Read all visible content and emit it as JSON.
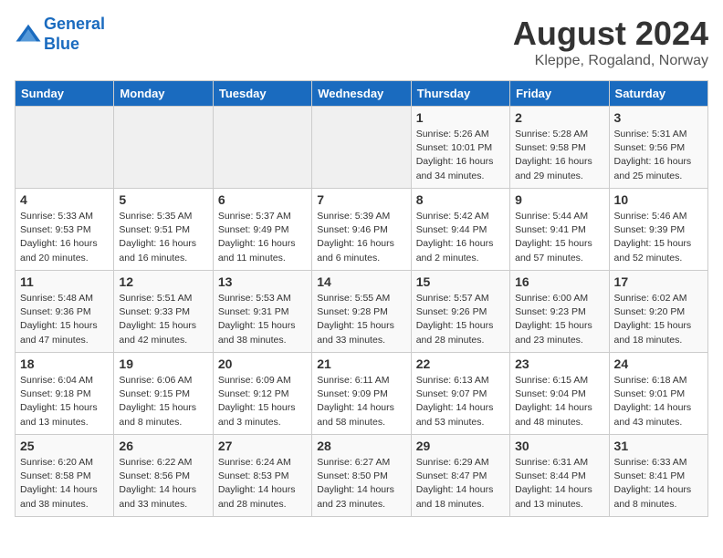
{
  "header": {
    "logo_line1": "General",
    "logo_line2": "Blue",
    "month_year": "August 2024",
    "location": "Kleppe, Rogaland, Norway"
  },
  "days_of_week": [
    "Sunday",
    "Monday",
    "Tuesday",
    "Wednesday",
    "Thursday",
    "Friday",
    "Saturday"
  ],
  "weeks": [
    [
      {
        "day": "",
        "detail": ""
      },
      {
        "day": "",
        "detail": ""
      },
      {
        "day": "",
        "detail": ""
      },
      {
        "day": "",
        "detail": ""
      },
      {
        "day": "1",
        "detail": "Sunrise: 5:26 AM\nSunset: 10:01 PM\nDaylight: 16 hours\nand 34 minutes."
      },
      {
        "day": "2",
        "detail": "Sunrise: 5:28 AM\nSunset: 9:58 PM\nDaylight: 16 hours\nand 29 minutes."
      },
      {
        "day": "3",
        "detail": "Sunrise: 5:31 AM\nSunset: 9:56 PM\nDaylight: 16 hours\nand 25 minutes."
      }
    ],
    [
      {
        "day": "4",
        "detail": "Sunrise: 5:33 AM\nSunset: 9:53 PM\nDaylight: 16 hours\nand 20 minutes."
      },
      {
        "day": "5",
        "detail": "Sunrise: 5:35 AM\nSunset: 9:51 PM\nDaylight: 16 hours\nand 16 minutes."
      },
      {
        "day": "6",
        "detail": "Sunrise: 5:37 AM\nSunset: 9:49 PM\nDaylight: 16 hours\nand 11 minutes."
      },
      {
        "day": "7",
        "detail": "Sunrise: 5:39 AM\nSunset: 9:46 PM\nDaylight: 16 hours\nand 6 minutes."
      },
      {
        "day": "8",
        "detail": "Sunrise: 5:42 AM\nSunset: 9:44 PM\nDaylight: 16 hours\nand 2 minutes."
      },
      {
        "day": "9",
        "detail": "Sunrise: 5:44 AM\nSunset: 9:41 PM\nDaylight: 15 hours\nand 57 minutes."
      },
      {
        "day": "10",
        "detail": "Sunrise: 5:46 AM\nSunset: 9:39 PM\nDaylight: 15 hours\nand 52 minutes."
      }
    ],
    [
      {
        "day": "11",
        "detail": "Sunrise: 5:48 AM\nSunset: 9:36 PM\nDaylight: 15 hours\nand 47 minutes."
      },
      {
        "day": "12",
        "detail": "Sunrise: 5:51 AM\nSunset: 9:33 PM\nDaylight: 15 hours\nand 42 minutes."
      },
      {
        "day": "13",
        "detail": "Sunrise: 5:53 AM\nSunset: 9:31 PM\nDaylight: 15 hours\nand 38 minutes."
      },
      {
        "day": "14",
        "detail": "Sunrise: 5:55 AM\nSunset: 9:28 PM\nDaylight: 15 hours\nand 33 minutes."
      },
      {
        "day": "15",
        "detail": "Sunrise: 5:57 AM\nSunset: 9:26 PM\nDaylight: 15 hours\nand 28 minutes."
      },
      {
        "day": "16",
        "detail": "Sunrise: 6:00 AM\nSunset: 9:23 PM\nDaylight: 15 hours\nand 23 minutes."
      },
      {
        "day": "17",
        "detail": "Sunrise: 6:02 AM\nSunset: 9:20 PM\nDaylight: 15 hours\nand 18 minutes."
      }
    ],
    [
      {
        "day": "18",
        "detail": "Sunrise: 6:04 AM\nSunset: 9:18 PM\nDaylight: 15 hours\nand 13 minutes."
      },
      {
        "day": "19",
        "detail": "Sunrise: 6:06 AM\nSunset: 9:15 PM\nDaylight: 15 hours\nand 8 minutes."
      },
      {
        "day": "20",
        "detail": "Sunrise: 6:09 AM\nSunset: 9:12 PM\nDaylight: 15 hours\nand 3 minutes."
      },
      {
        "day": "21",
        "detail": "Sunrise: 6:11 AM\nSunset: 9:09 PM\nDaylight: 14 hours\nand 58 minutes."
      },
      {
        "day": "22",
        "detail": "Sunrise: 6:13 AM\nSunset: 9:07 PM\nDaylight: 14 hours\nand 53 minutes."
      },
      {
        "day": "23",
        "detail": "Sunrise: 6:15 AM\nSunset: 9:04 PM\nDaylight: 14 hours\nand 48 minutes."
      },
      {
        "day": "24",
        "detail": "Sunrise: 6:18 AM\nSunset: 9:01 PM\nDaylight: 14 hours\nand 43 minutes."
      }
    ],
    [
      {
        "day": "25",
        "detail": "Sunrise: 6:20 AM\nSunset: 8:58 PM\nDaylight: 14 hours\nand 38 minutes."
      },
      {
        "day": "26",
        "detail": "Sunrise: 6:22 AM\nSunset: 8:56 PM\nDaylight: 14 hours\nand 33 minutes."
      },
      {
        "day": "27",
        "detail": "Sunrise: 6:24 AM\nSunset: 8:53 PM\nDaylight: 14 hours\nand 28 minutes."
      },
      {
        "day": "28",
        "detail": "Sunrise: 6:27 AM\nSunset: 8:50 PM\nDaylight: 14 hours\nand 23 minutes."
      },
      {
        "day": "29",
        "detail": "Sunrise: 6:29 AM\nSunset: 8:47 PM\nDaylight: 14 hours\nand 18 minutes."
      },
      {
        "day": "30",
        "detail": "Sunrise: 6:31 AM\nSunset: 8:44 PM\nDaylight: 14 hours\nand 13 minutes."
      },
      {
        "day": "31",
        "detail": "Sunrise: 6:33 AM\nSunset: 8:41 PM\nDaylight: 14 hours\nand 8 minutes."
      }
    ]
  ]
}
